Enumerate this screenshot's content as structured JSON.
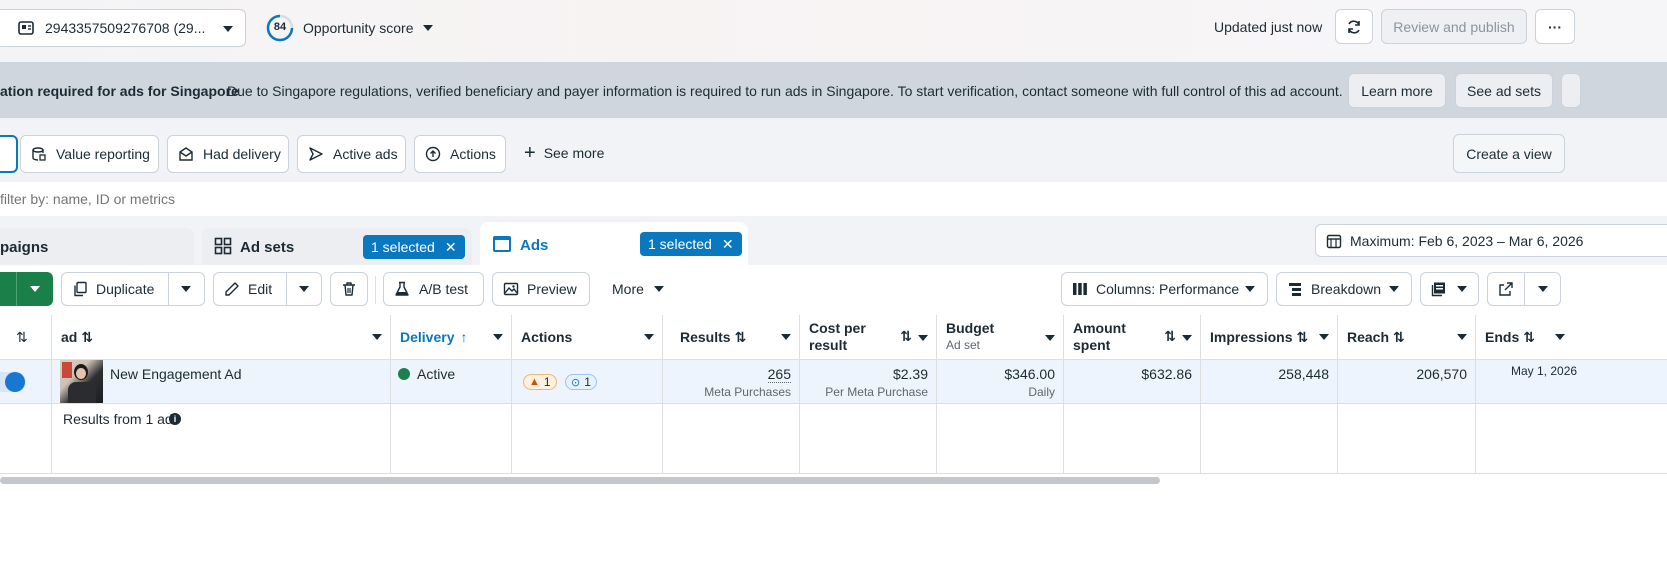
{
  "topbar": {
    "account_id": "2943357509276708 (29...",
    "score_value": "84",
    "score_label": "Opportunity score",
    "updated": "Updated just now",
    "review_publish": "Review and publish"
  },
  "alert": {
    "title": "ation required for ads for Singapore",
    "message": "Due to Singapore regulations, verified beneficiary and payer information is required to run ads in Singapore. To start verification, contact someone with full control of this ad account.",
    "learn_more": "Learn more",
    "see_ad_sets": "See ad sets"
  },
  "filters": {
    "items": [
      "Value reporting",
      "Had delivery",
      "Active ads",
      "Actions"
    ],
    "see_more": "See more",
    "create_view": "Create a view"
  },
  "search": {
    "placeholder": "filter by: name, ID or metrics"
  },
  "tabs": {
    "campaigns": "paigns",
    "adsets": "Ad sets",
    "adsets_selected": "1 selected",
    "ads": "Ads",
    "ads_selected": "1 selected",
    "date_range": "Maximum: Feb 6, 2023 – Mar 6, 2026"
  },
  "toolbar": {
    "duplicate": "Duplicate",
    "edit": "Edit",
    "ab_test": "A/B test",
    "preview": "Preview",
    "more": "More",
    "columns": "Columns: Performance",
    "breakdown": "Breakdown"
  },
  "table": {
    "headers": {
      "ad": "ad",
      "delivery": "Delivery",
      "actions": "Actions",
      "results": "Results",
      "cost_line1": "Cost per",
      "cost_line2": "result",
      "budget": "Budget",
      "budget_sub": "Ad set",
      "amount_line1": "Amount",
      "amount_line2": "spent",
      "impressions": "Impressions",
      "reach": "Reach",
      "ends": "Ends"
    },
    "row": {
      "ad_name": "New Engagement Ad",
      "delivery": "Active",
      "warning_count": "1",
      "insight_count": "1",
      "results": "265",
      "results_sub": "Meta Purchases",
      "cost": "$2.39",
      "cost_sub": "Per Meta Purchase",
      "budget": "$346.00",
      "budget_sub": "Daily",
      "amount_spent": "$632.86",
      "impressions": "258,448",
      "reach": "206,570",
      "ends": "May 1, 2026"
    },
    "footer": {
      "results_from": "Results from 1 ad"
    }
  },
  "colors": {
    "accent": "#0a78be",
    "active_green": "#1e7f4e",
    "primary_green": "#1a7f48"
  }
}
